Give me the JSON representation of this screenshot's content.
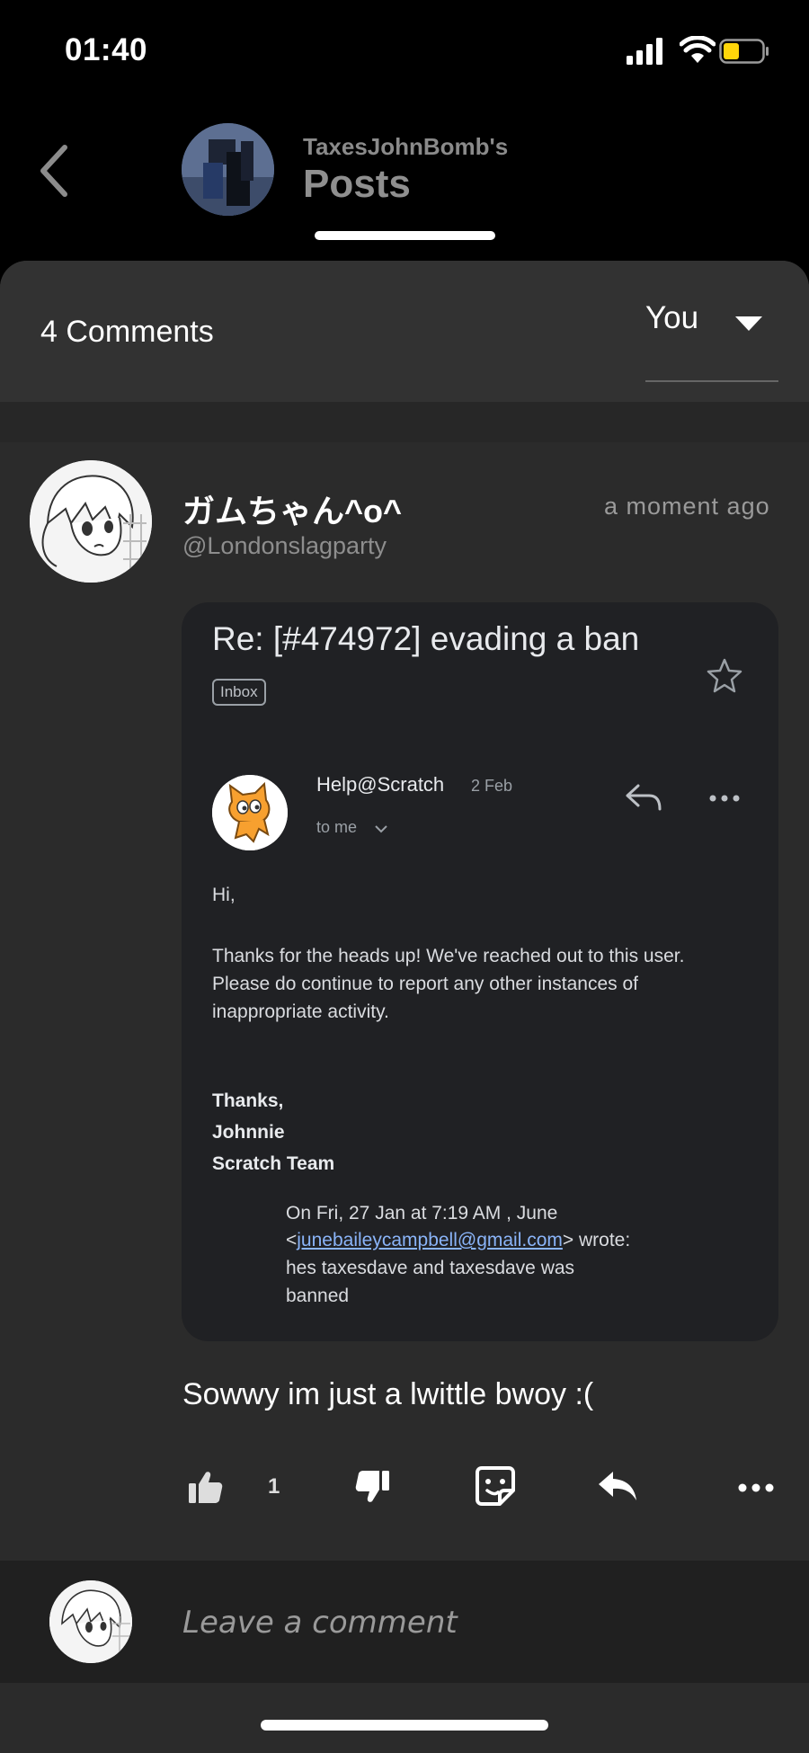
{
  "status_bar": {
    "time": "01:40"
  },
  "header": {
    "subtitle": "TaxesJohnBomb's",
    "title": "Posts"
  },
  "comments_bar": {
    "count_label": "4 Comments",
    "sort_value": "You"
  },
  "comment": {
    "author": "ガムちゃん^o^",
    "handle": "@Londonslagparty",
    "time": "a moment ago",
    "text": "Sowwy im just a lwittle bwoy :(",
    "like_count": "1"
  },
  "email": {
    "subject": "Re: [#474972] evading a ban",
    "label": "Inbox",
    "sender": "Help@Scratch",
    "date": "2 Feb",
    "to": "to me",
    "greeting": "Hi,",
    "body": [
      "Thanks for the heads up! We've reached out to this user.",
      "Please do continue to report any other instances of",
      "inappropriate activity."
    ],
    "signature": [
      "Thanks,",
      "Johnnie",
      "Scratch Team"
    ],
    "quote": {
      "line1": "On Fri, 27 Jan at 7:19 AM , June",
      "line2_prefix": "<",
      "line2_email": "junebaileycampbell@gmail.com",
      "line2_suffix": "> wrote:",
      "line3": "hes taxesdave and taxesdave was",
      "line4": "banned"
    }
  },
  "composer": {
    "placeholder": "Leave a comment"
  },
  "colors": {
    "sheet": "#2b2b2b",
    "header_bar": "#323232",
    "email_card": "#202124",
    "link": "#8ab4f8",
    "battery": "#ffd60a"
  },
  "icons": [
    "back-arrow-icon",
    "signal-icon",
    "wifi-icon",
    "battery-icon",
    "chevron-down-icon",
    "star-icon",
    "reply-icon",
    "more-icon",
    "thumbs-up-icon",
    "thumbs-down-icon",
    "sticker-icon"
  ]
}
